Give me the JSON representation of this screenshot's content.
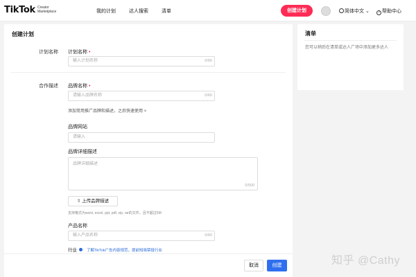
{
  "header": {
    "logo_main": "TikTok",
    "logo_sub": "Creator Marketplace",
    "nav": [
      "我的计划",
      "达人搜索",
      "清单"
    ],
    "create_label": "创建计划",
    "language": "简体中文",
    "help": "帮助中心"
  },
  "form": {
    "title": "创建计划",
    "plan_section_label": "计划名称",
    "plan_name_label": "计划名称",
    "plan_name_placeholder": "输入计划名称",
    "plan_name_counter": "0/60",
    "coop_section_label": "合作描述",
    "brand_name_label": "品牌名称",
    "brand_name_placeholder": "请输入品牌名称",
    "brand_name_counter": "0/60",
    "brand_hint": "添加常用推广品牌和描述，之后快速使用",
    "brand_hint_close": "×",
    "brand_site_label": "品牌网站",
    "brand_site_placeholder": "请输入",
    "brand_detail_label": "品牌详细描述",
    "brand_detail_placeholder": "品牌详细描述",
    "brand_detail_counter": "0/500",
    "upload_label": "上传品牌描述",
    "upload_tip": "支持格式为word, excel, ppt, pdf, zip, rar的文件，且不超过5M",
    "product_name_label": "产品名称",
    "product_name_placeholder": "输入产品名称",
    "product_name_counter": "0/60",
    "industry_label": "行业",
    "industry_link": "了解TikTok广告内容规范，提前知晓禁投行业"
  },
  "footer": {
    "cancel": "取消",
    "submit": "创建"
  },
  "side": {
    "title": "清单",
    "desc": "您可以稍后在清单或达人广场中添加更多达人"
  },
  "watermark": "知乎 @Cathy",
  "colors": {
    "brand_red": "#fe2c55",
    "primary_blue": "#2f6fef",
    "link_blue": "#2a6bd8"
  }
}
